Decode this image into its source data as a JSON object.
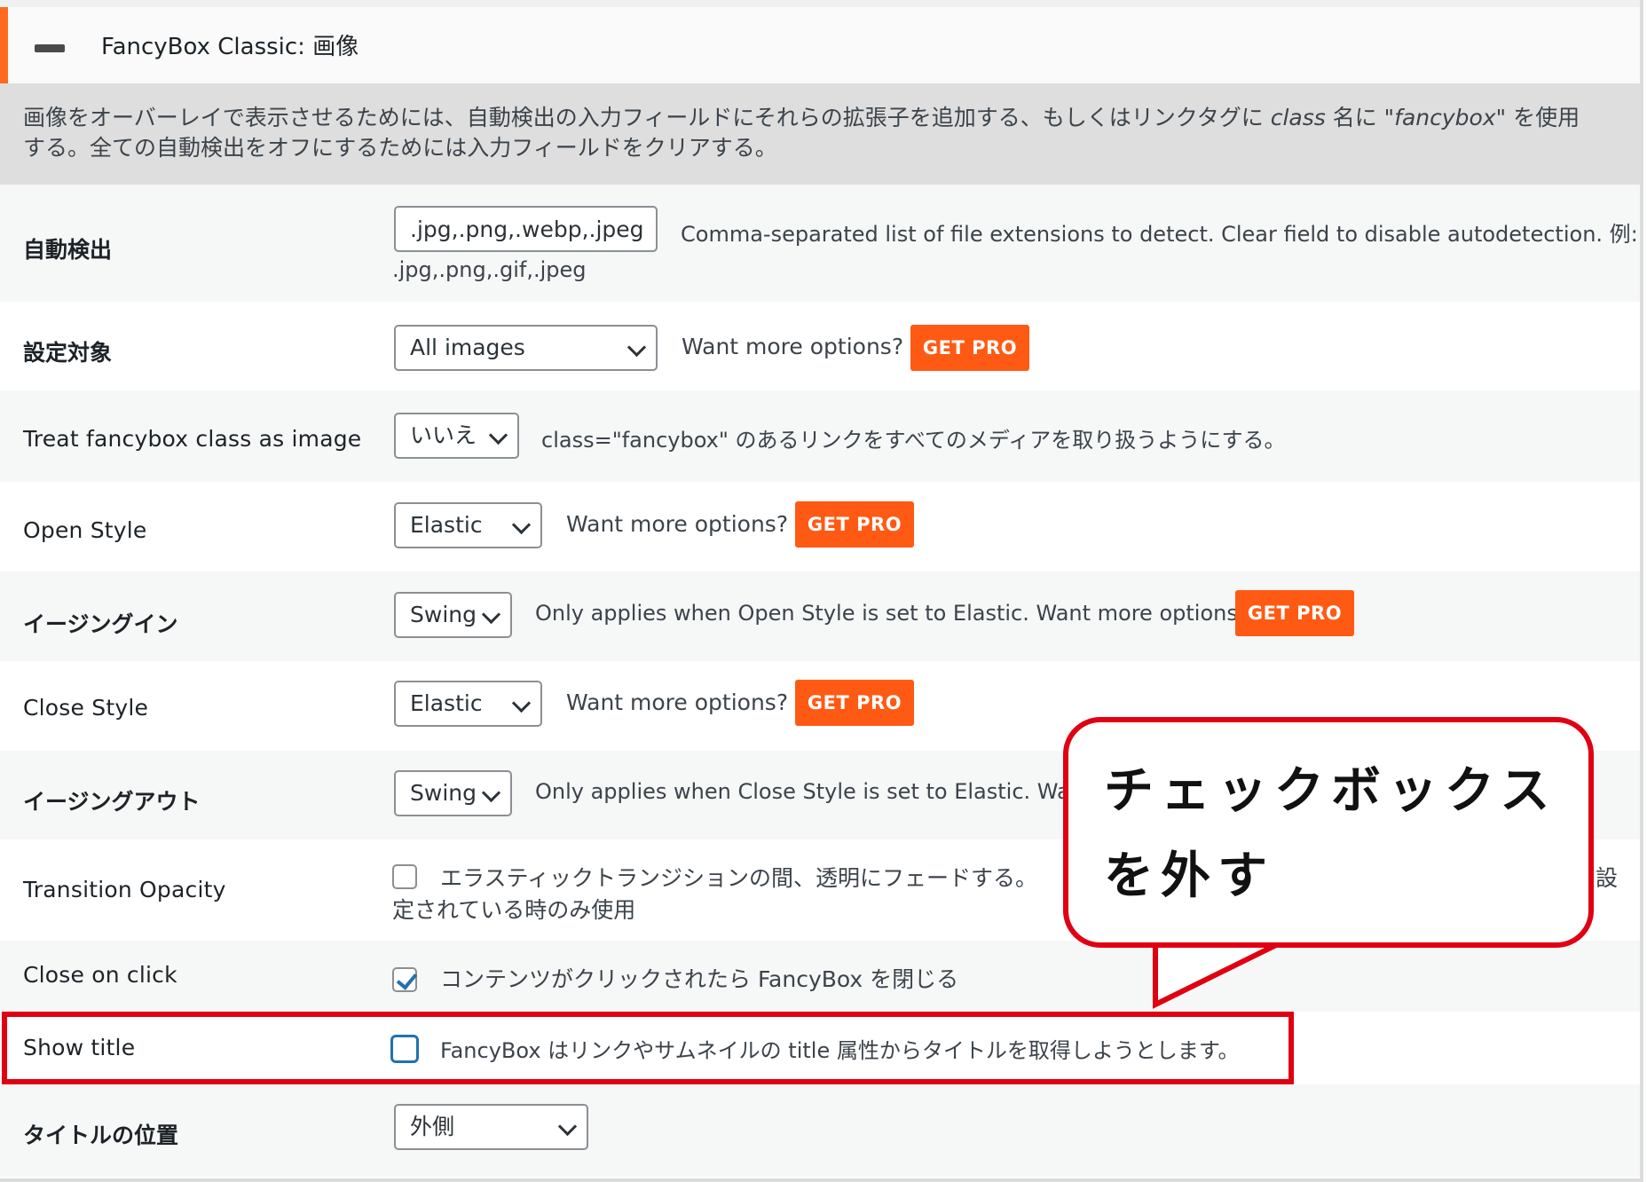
{
  "header": {
    "title": "FancyBox Classic: 画像"
  },
  "description": {
    "line1_pre": "画像をオーバーレイで表示させるためには、自動検出の入力フィールドにそれらの拡張子を追加する、もしくはリンクタグに ",
    "line1_class": "class",
    "line1_mid": " 名に ",
    "line1_fancy": "\"fancybox\"",
    "line1_post": " を使用",
    "line2": "する。全ての自動検出をオフにするためには入力フィールドをクリアする。"
  },
  "rows": {
    "autodetect": {
      "label": "自動検出",
      "value": ".jpg,.png,.webp,.jpeg",
      "help1": "Comma-separated list of file extensions to detect. Clear field to disable autodetection. 例:",
      "help2": ".jpg,.png,.gif,.jpeg"
    },
    "target": {
      "label": "設定対象",
      "selected": "All images",
      "help": "Want more options?",
      "pro": "GET PRO"
    },
    "treat_class": {
      "label": "Treat fancybox class as image",
      "selected": "いいえ",
      "help": "class=\"fancybox\" のあるリンクをすべてのメディアを取り扱うようにする。"
    },
    "open_style": {
      "label": "Open Style",
      "selected": "Elastic",
      "help": "Want more options?",
      "pro": "GET PRO"
    },
    "easing_in": {
      "label": "イージングイン",
      "selected": "Swing",
      "help": "Only applies when Open Style is set to Elastic. Want more options?",
      "pro": "GET PRO"
    },
    "close_style": {
      "label": "Close Style",
      "selected": "Elastic",
      "help": "Want more options?",
      "pro": "GET PRO"
    },
    "easing_out": {
      "label": "イージングアウト",
      "selected": "Swing",
      "help": "Only applies when Close Style is set to Elastic. Want"
    },
    "transition_opacity": {
      "label": "Transition Opacity",
      "checked": false,
      "help1": "エラスティックトランジションの間、透明にフェードする。",
      "help1_tail": "設",
      "help2": "定されている時のみ使用"
    },
    "close_on_click": {
      "label": "Close on click",
      "checked": true,
      "help": "コンテンツがクリックされたら FancyBox を閉じる"
    },
    "show_title": {
      "label": "Show title",
      "checked": false,
      "help": "FancyBox はリンクやサムネイルの title 属性からタイトルを取得しようとします。"
    },
    "title_position": {
      "label": "タイトルの位置",
      "selected": "外側"
    }
  },
  "callout": {
    "line1": "チェックボックス",
    "line2": "を外す"
  },
  "colors": {
    "accent": "#ff5a14",
    "highlight": "#e00012",
    "checkbox_blue": "#2271b1",
    "header_stripe": "#ff6a1f"
  }
}
